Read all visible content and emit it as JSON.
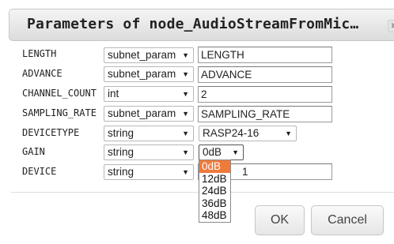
{
  "dialog": {
    "title": "Parameters of node_AudioStreamFromMic…",
    "close_glyph": "✖",
    "params": [
      {
        "name": "LENGTH",
        "type": "subnet_param",
        "value": "LENGTH"
      },
      {
        "name": "ADVANCE",
        "type": "subnet_param",
        "value": "ADVANCE"
      },
      {
        "name": "CHANNEL_COUNT",
        "type": "int",
        "value": "2"
      },
      {
        "name": "SAMPLING_RATE",
        "type": "subnet_param",
        "value": "SAMPLING_RATE"
      },
      {
        "name": "DEVICETYPE",
        "type": "string",
        "value": "RASP24-16"
      },
      {
        "name": "GAIN",
        "type": "string",
        "value": "0dB"
      },
      {
        "name": "DEVICE",
        "type": "string",
        "value": "1"
      }
    ],
    "gain_options": [
      "0dB",
      "12dB",
      "24dB",
      "36dB",
      "48dB"
    ],
    "gain_selected_index": 0,
    "ok_label": "OK",
    "cancel_label": "Cancel",
    "highlight_color": "#ef7a3c"
  }
}
